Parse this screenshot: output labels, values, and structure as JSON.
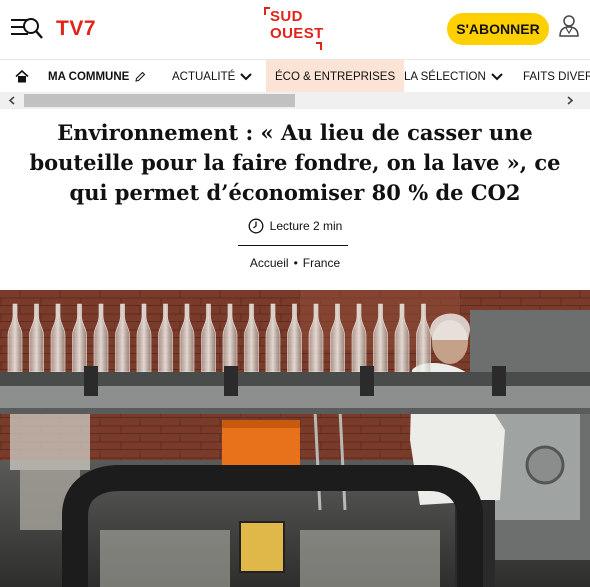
{
  "header": {
    "channel": "TV7",
    "logo_line1": "SUD",
    "logo_line2": "OUEST",
    "subscribe_label": "S'ABONNER"
  },
  "nav": {
    "items": [
      {
        "label": "MA COMMUNE"
      },
      {
        "label": "ACTUALITÉ"
      },
      {
        "label": "ÉCO & ENTREPRISES"
      },
      {
        "label": "LA SÉLECTION"
      },
      {
        "label": "FAITS DIVERS"
      }
    ]
  },
  "article": {
    "title": "Environnement : « Au lieu de casser une bouteille pour la faire fondre, on la lave », ce qui permet d’économiser 80 % de CO2",
    "reading_time": "Lecture 2 min",
    "breadcrumb": [
      "Accueil",
      "France"
    ]
  },
  "colors": {
    "brand_red": "#e2231a",
    "subscribe_yellow": "#ffd000",
    "active_tab_bg": "#fbe3d6"
  }
}
